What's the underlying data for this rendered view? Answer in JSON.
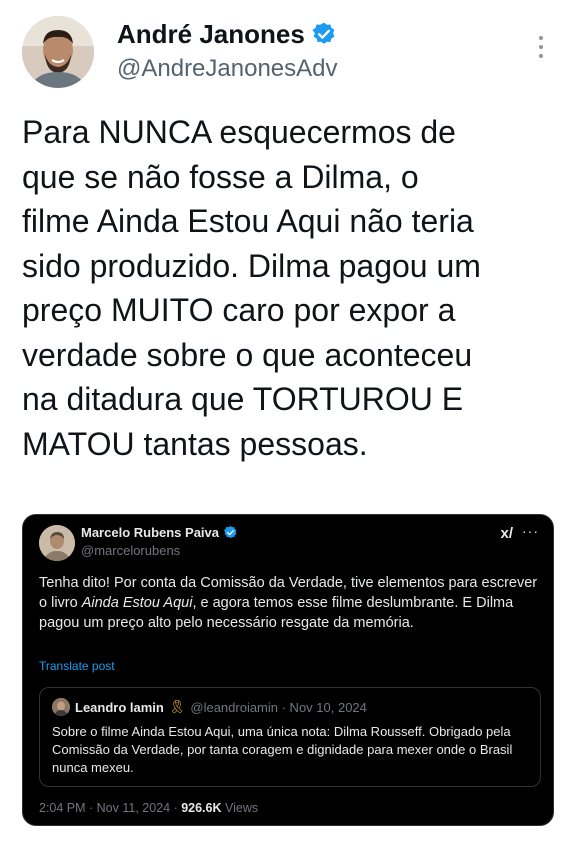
{
  "author": {
    "name": "André Janones",
    "handle": "@AndreJanonesAdv",
    "verified": true
  },
  "tweet": {
    "text": "Para NUNCA esquecermos de\nque se não fosse a Dilma, o\nfilme Ainda Estou Aqui não teria\nsido produzido. Dilma pagou um\npreço MUITO caro por expor a\nverdade sobre o que aconteceu\nna ditadura que TORTUROU E\nMATOU tantas pessoas."
  },
  "quoted": {
    "name": "Marcelo Rubens Paiva",
    "handle": "@marcelorubens",
    "grok_label": "x/",
    "more_label": "···",
    "text_part1": "Tenha dito! Por conta da Comissão da Verdade, tive elementos para escrever o livro ",
    "text_italic": "Ainda Estou Aqui",
    "text_part2": ", e agora temos esse filme deslumbrante. E Dilma pagou um preço alto pelo necessário resgate da memória.",
    "translate_label": "Translate post",
    "inner": {
      "name": "Leandro lamin",
      "ribbon": "🎗",
      "handle_date": "@leandroiamin · Nov 10, 2024",
      "text": "Sobre o filme Ainda Estou Aqui, uma única nota: Dilma Rousseff. Obrigado pela Comissão da Verdade, por tanta coragem e dignidade para mexer onde o Brasil nunca mexeu."
    },
    "timestamp": "2:04 PM · Nov 11, 2024 · ",
    "views_count": "926.6K",
    "views_label": " Views"
  },
  "colors": {
    "verified": "#1d9bf0",
    "text": "#0f1419",
    "muted": "#536471"
  }
}
